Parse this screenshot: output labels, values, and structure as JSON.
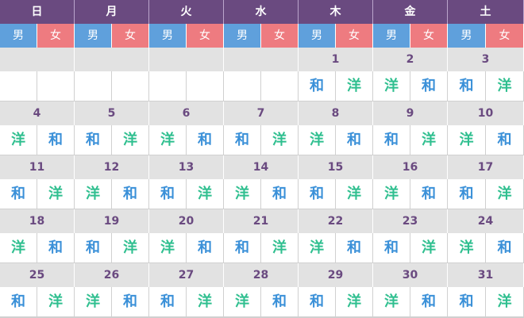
{
  "weekdays": [
    "日",
    "月",
    "火",
    "水",
    "木",
    "金",
    "土"
  ],
  "gender_labels": {
    "male": "男",
    "female": "女"
  },
  "symbols": {
    "wa": "和",
    "yo": "洋"
  },
  "colors": {
    "header": "#6a4a80",
    "male": "#5fa0dc",
    "female": "#ee7b80",
    "wa": "#3a90d8",
    "yo": "#2fbf8f",
    "date_bg": "#e2e2e2"
  },
  "weeks": [
    {
      "dates": [
        "",
        "",
        "",
        "",
        "1",
        "2",
        "3"
      ],
      "marks": [
        [
          "",
          ""
        ],
        [
          "",
          ""
        ],
        [
          "",
          ""
        ],
        [
          "",
          ""
        ],
        [
          "和",
          "洋"
        ],
        [
          "洋",
          "和"
        ],
        [
          "和",
          "洋"
        ]
      ]
    },
    {
      "dates": [
        "4",
        "5",
        "6",
        "7",
        "8",
        "9",
        "10"
      ],
      "marks": [
        [
          "洋",
          "和"
        ],
        [
          "和",
          "洋"
        ],
        [
          "洋",
          "和"
        ],
        [
          "和",
          "洋"
        ],
        [
          "洋",
          "和"
        ],
        [
          "和",
          "洋"
        ],
        [
          "洋",
          "和"
        ]
      ]
    },
    {
      "dates": [
        "11",
        "12",
        "13",
        "14",
        "15",
        "16",
        "17"
      ],
      "marks": [
        [
          "和",
          "洋"
        ],
        [
          "洋",
          "和"
        ],
        [
          "和",
          "洋"
        ],
        [
          "洋",
          "和"
        ],
        [
          "和",
          "洋"
        ],
        [
          "洋",
          "和"
        ],
        [
          "和",
          "洋"
        ]
      ]
    },
    {
      "dates": [
        "18",
        "19",
        "20",
        "21",
        "22",
        "23",
        "24"
      ],
      "marks": [
        [
          "洋",
          "和"
        ],
        [
          "和",
          "洋"
        ],
        [
          "洋",
          "和"
        ],
        [
          "和",
          "洋"
        ],
        [
          "洋",
          "和"
        ],
        [
          "和",
          "洋"
        ],
        [
          "洋",
          "和"
        ]
      ]
    },
    {
      "dates": [
        "25",
        "26",
        "27",
        "28",
        "29",
        "30",
        "31"
      ],
      "marks": [
        [
          "和",
          "洋"
        ],
        [
          "洋",
          "和"
        ],
        [
          "和",
          "洋"
        ],
        [
          "洋",
          "和"
        ],
        [
          "和",
          "洋"
        ],
        [
          "洋",
          "和"
        ],
        [
          "和",
          "洋"
        ]
      ]
    }
  ]
}
